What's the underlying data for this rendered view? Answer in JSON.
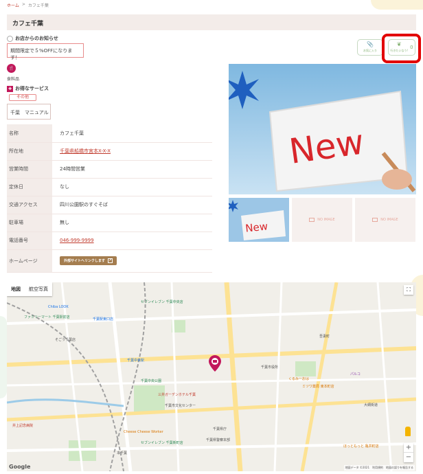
{
  "breadcrumb": {
    "home": "ホーム",
    "sep": ">",
    "current": "カフェ千葉"
  },
  "page_title": "カフェ千葉",
  "notice": {
    "heading": "お店からのお知らせ",
    "text": "期間限定で５%OFFになります！"
  },
  "actions": {
    "favorite_label": "お気に入り",
    "go_label": "行きたいなう!",
    "go_count": "0"
  },
  "category": {
    "icon_text": "🍴",
    "label": "食料品"
  },
  "services": {
    "heading": "お得なサービス",
    "tag": "その他"
  },
  "keywords": "千葉　マニュアル",
  "info": {
    "name_key": "名称",
    "name_value": "カフェ千葉",
    "address_key": "所在地",
    "address_value": "千葉県船橋市宮本X-X-X",
    "hours_key": "営業時間",
    "hours_value": "24時間営業",
    "holiday_key": "定休日",
    "holiday_value": "なし",
    "access_key": "交通アクセス",
    "access_value": "四川公園駅のすぐそば",
    "parking_key": "駐車場",
    "parking_value": "無し",
    "phone_key": "電話番号",
    "phone_value": "046-999-9999",
    "homepage_key": "ホームページ",
    "homepage_button": "外部サイトへリンクします"
  },
  "photos": {
    "main_text": "New",
    "thumb1_text": "New",
    "noimage_label": "NO IMAGE"
  },
  "map": {
    "tab_map": "地図",
    "tab_satellite": "航空写真",
    "google": "Google",
    "attribution": "地図データ ©2021　利用規約　地図の誤りを報告する",
    "labels": [
      {
        "text": "Chiba LOOK",
        "cls": "blue"
      },
      {
        "text": "ファミリーマート 千葉駅前店",
        "cls": "green"
      },
      {
        "text": "千葉駅東口店",
        "cls": "blue"
      },
      {
        "text": "そごう千葉店",
        "cls": ""
      },
      {
        "text": "セブンイレブン 千葉中央店",
        "cls": "green"
      },
      {
        "text": "千葉中央駅",
        "cls": "blue"
      },
      {
        "text": "三井ガーデンホテル千葉",
        "cls": "red"
      },
      {
        "text": "千葉市文化センター",
        "cls": ""
      },
      {
        "text": "セブンイレブン 千葉新町店",
        "cls": "green"
      },
      {
        "text": "千葉市役所",
        "cls": ""
      },
      {
        "text": "千葉県庁",
        "cls": ""
      },
      {
        "text": "千葉中央公園",
        "cls": "green"
      },
      {
        "text": "くるみーおは",
        "cls": "orange"
      },
      {
        "text": "ミツワ薬局 東本町店",
        "cls": "orange"
      },
      {
        "text": "千葉県警察本部",
        "cls": ""
      },
      {
        "text": "パルコ",
        "cls": "purple"
      },
      {
        "text": "ほっともっと 亀井町店",
        "cls": "orange"
      },
      {
        "text": "井上記念病院",
        "cls": "red"
      },
      {
        "text": "Cheese Cheese Worker",
        "cls": "orange"
      },
      {
        "text": "吾妻町",
        "cls": ""
      },
      {
        "text": "本千葉",
        "cls": ""
      },
      {
        "text": "大網街道",
        "cls": ""
      }
    ]
  }
}
